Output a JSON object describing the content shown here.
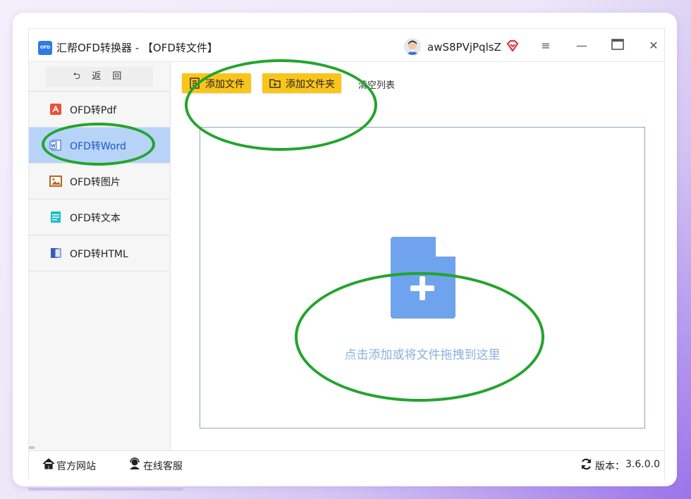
{
  "window": {
    "logo_text": "OFD",
    "title": "汇帮OFD转换器 - 【OFD转文件】",
    "username": "awS8PVjPqlsZ",
    "controls": {
      "menu": "≡",
      "minimize": "—",
      "maximize": "▭",
      "close": "✕"
    }
  },
  "sidebar": {
    "back_label": "⮌ 返 回",
    "items": [
      {
        "label": "OFD转Pdf",
        "icon": "pdf-icon",
        "color": "#e8533a",
        "active": false
      },
      {
        "label": "OFD转Word",
        "icon": "word-icon",
        "color": "#2a5bd7",
        "active": true
      },
      {
        "label": "OFD转图片",
        "icon": "image-icon",
        "color": "#b8651b",
        "active": false
      },
      {
        "label": "OFD转文本",
        "icon": "text-icon",
        "color": "#1cc0c6",
        "active": false
      },
      {
        "label": "OFD转HTML",
        "icon": "html-icon",
        "color": "#3b5bb5",
        "active": false
      }
    ]
  },
  "toolbar": {
    "add_file": "添加文件",
    "add_folder": "添加文件夹",
    "clear_list": "清空列表"
  },
  "dropzone": {
    "hint": "点击添加或将文件拖拽到这里"
  },
  "footer": {
    "website": "官方网站",
    "support": "在线客服",
    "version_label": "版本：",
    "version": "3.6.0.0"
  },
  "colors": {
    "accent_yellow": "#fac51b",
    "active_item_bg": "#b7d3f7",
    "annotation_green": "#22a52c",
    "dropzone_icon": "#6fa3ee"
  }
}
